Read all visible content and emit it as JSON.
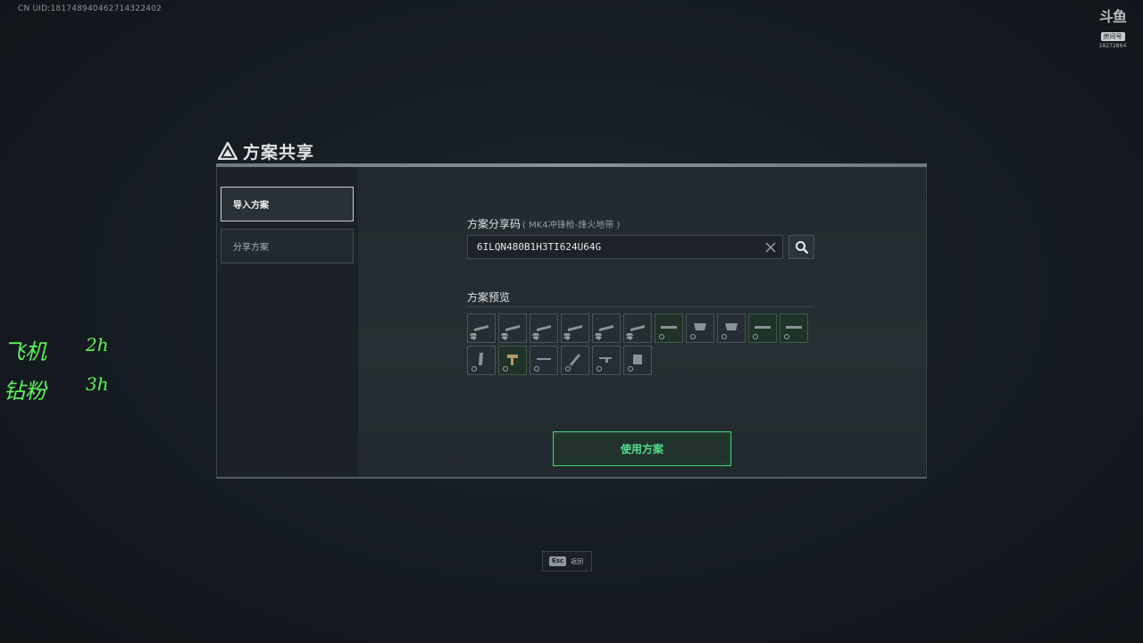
{
  "header": {
    "uid": "CN UID:181748940462714322402"
  },
  "watermark": {
    "logo": "斗鱼",
    "tag": "房间号",
    "room": "18272864"
  },
  "overlay": {
    "lines": [
      {
        "name": "飞机",
        "duration": "2h"
      },
      {
        "name": "钻粉",
        "duration": "3h"
      }
    ]
  },
  "dialog": {
    "title": "方案共享",
    "tabs": [
      {
        "label": "导入方案",
        "active": true
      },
      {
        "label": "分享方案",
        "active": false
      }
    ],
    "share_code": {
      "label": "方案分享码",
      "sublabel": "( MK4冲锋枪-烽火地带 )",
      "value": "6ILQN480B1H3TI624U64G"
    },
    "preview": {
      "label": "方案预览",
      "slots_row1": [
        {
          "icon": "weapon-part-icon",
          "badge": "零",
          "green": false
        },
        {
          "icon": "weapon-part-icon",
          "badge": "零",
          "green": false
        },
        {
          "icon": "weapon-part-icon",
          "badge": "零",
          "green": false
        },
        {
          "icon": "weapon-part-icon",
          "badge": "零",
          "green": false
        },
        {
          "icon": "weapon-part-icon",
          "badge": "零",
          "green": false
        },
        {
          "icon": "weapon-part-icon",
          "badge": "零",
          "green": false
        },
        {
          "icon": "rail-icon",
          "badge": "",
          "green": true
        },
        {
          "icon": "handguard-icon",
          "badge": "",
          "green": false
        },
        {
          "icon": "handguard-icon",
          "badge": "",
          "green": false
        },
        {
          "icon": "rail-icon",
          "badge": "",
          "green": true
        },
        {
          "icon": "rail-icon",
          "badge": "",
          "green": true
        }
      ],
      "slots_row2": [
        {
          "icon": "magazine-icon",
          "badge": "",
          "green": false
        },
        {
          "icon": "grip-icon",
          "badge": "",
          "green": true
        },
        {
          "icon": "scope-icon",
          "badge": "",
          "green": false
        },
        {
          "icon": "muzzle-icon",
          "badge": "",
          "green": false
        },
        {
          "icon": "stock-icon",
          "badge": "",
          "green": false
        },
        {
          "icon": "barrel-icon",
          "badge": "",
          "green": false
        }
      ]
    },
    "use_button": "使用方案"
  },
  "footer": {
    "esc_key": "Esc",
    "esc_label": "返回"
  },
  "colors": {
    "accent_green": "#3fd17a",
    "handwriting_green": "#5df55a"
  }
}
